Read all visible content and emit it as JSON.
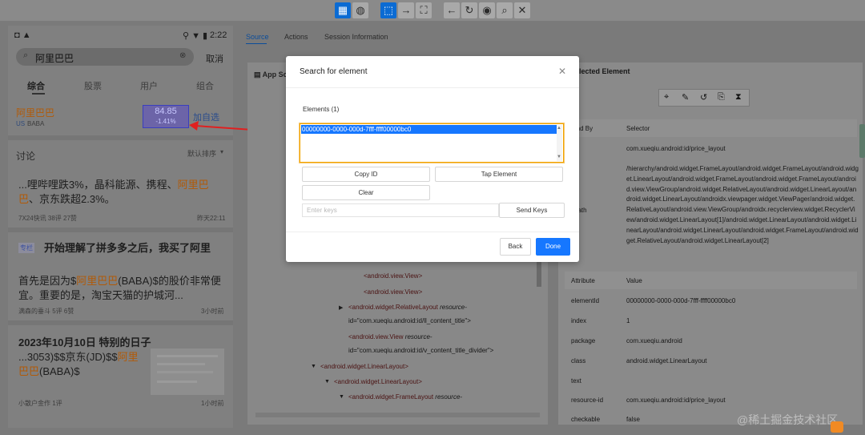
{
  "toolbar": {
    "icons": [
      "select-icon",
      "globe-icon",
      "tap-icon",
      "swipe-icon",
      "resize-icon",
      "back-icon",
      "refresh-icon",
      "eye-icon",
      "search-icon",
      "close-icon"
    ]
  },
  "phone": {
    "status_time": "2:22",
    "search_value": "阿里巴巴",
    "cancel": "取消",
    "tabs": [
      "综合",
      "股票",
      "用户",
      "组合"
    ],
    "stock": {
      "name": "阿里巴巴",
      "market": "US",
      "code": "BABA",
      "price": "84.85",
      "change": "-1.41%",
      "add": "加自选"
    },
    "discussion": "讨论",
    "sort": "默认排序",
    "posts": [
      {
        "text_prefix": "...哩哔哩跌3%，晶科能源、携程、",
        "text_hl": "阿里巴巴",
        "text_suffix": "、京东跌超2.3%。",
        "meta_left": "7X24快讯  38评  27赞",
        "meta_right": "昨天22:11"
      },
      {
        "tag": "专栏",
        "title": "开始理解了拼多多之后，我买了阿里",
        "body_prefix": "首先是因为$",
        "body_hl": "阿里巴巴",
        "body_suffix": "(BABA)$的股价非常便宜。重要的是，淘宝天猫的护城河...",
        "meta_left": "满森的垂斗  5评  6赞",
        "meta_right": "3小时前"
      },
      {
        "title": "2023年10月10日 特别的日子",
        "body_prefix": "...3053)$$京东(JD)$$",
        "body_hl": "阿里巴巴",
        "body_suffix": "(BABA)$",
        "meta_left": "小散户金作  1评",
        "meta_right": "1小时前"
      }
    ]
  },
  "source_panel": {
    "tabs": [
      "Source",
      "Actions",
      "Session Information"
    ],
    "title": "App Source",
    "lines": [
      {
        "t": "<android.view.View>",
        "indent": 0,
        "caret": false
      },
      {
        "t": "<android.view.View>",
        "indent": 0,
        "caret": false
      },
      {
        "t": "<android.widget.RelativeLayout",
        "attr": " resource-",
        "indent": -1,
        "caret": true
      },
      {
        "t": "id=\"com.xueqiu.android:id/ll_content_title\">",
        "indent": 0,
        "caret": false
      },
      {
        "t": "<android.view.View",
        "attr": " resource-",
        "indent": -1,
        "caret": false
      },
      {
        "t": "id=\"com.xueqiu.android:id/v_content_title_divider\">",
        "indent": 0,
        "caret": false
      },
      {
        "t": "<android.widget.LinearLayout>",
        "indent": -4,
        "caret": true
      },
      {
        "t": "<android.widget.LinearLayout>",
        "indent": -3,
        "caret": true
      },
      {
        "t": "<android.widget.FrameLayout",
        "attr": " resource-",
        "indent": -2,
        "caret": true
      }
    ]
  },
  "selected": {
    "title": "Selected Element",
    "col_find": "Find By",
    "col_selector": "Selector",
    "rows": [
      {
        "k": "id",
        "v": "com.xueqiu.android:id/price_layout"
      },
      {
        "k": "xpath",
        "v": "/hierarchy/android.widget.FrameLayout/android.widget.FrameLayout/android.widget.LinearLayout/android.widget.FrameLayout/android.widget.FrameLayout/android.view.ViewGroup/android.widget.RelativeLayout/android.widget.LinearLayout/android.widget.LinearLayout/androidx.viewpager.widget.ViewPager/android.widget.RelativeLayout/android.view.ViewGroup/androidx.recyclerview.widget.RecyclerView/android.widget.LinearLayout[1]/android.widget.LinearLayout/android.widget.LinearLayout/android.widget.LinearLayout/android.widget.FrameLayout/android.widget.RelativeLayout/android.widget.LinearLayout[2]"
      }
    ],
    "attr_header": "Attribute",
    "value_header": "Value",
    "attrs": [
      {
        "k": "elementId",
        "v": "00000000-0000-000d-7fff-ffff00000bc0"
      },
      {
        "k": "index",
        "v": "1"
      },
      {
        "k": "package",
        "v": "com.xueqiu.android"
      },
      {
        "k": "class",
        "v": "android.widget.LinearLayout"
      },
      {
        "k": "text",
        "v": ""
      },
      {
        "k": "resource-id",
        "v": "com.xueqiu.android:id/price_layout"
      },
      {
        "k": "checkable",
        "v": "false"
      }
    ]
  },
  "modal": {
    "title": "Search for element",
    "elements_label": "Elements (1)",
    "selected_element": "00000000-0000-000d-7fff-ffff00000bc0",
    "copy_id": "Copy ID",
    "tap": "Tap Element",
    "clear": "Clear",
    "keys_placeholder": "Enter keys",
    "send_keys": "Send Keys",
    "back": "Back",
    "done": "Done",
    "accent": "#1677ff",
    "highlight_border": "#f2a400"
  },
  "watermark": "@稀土掘金技术社区"
}
